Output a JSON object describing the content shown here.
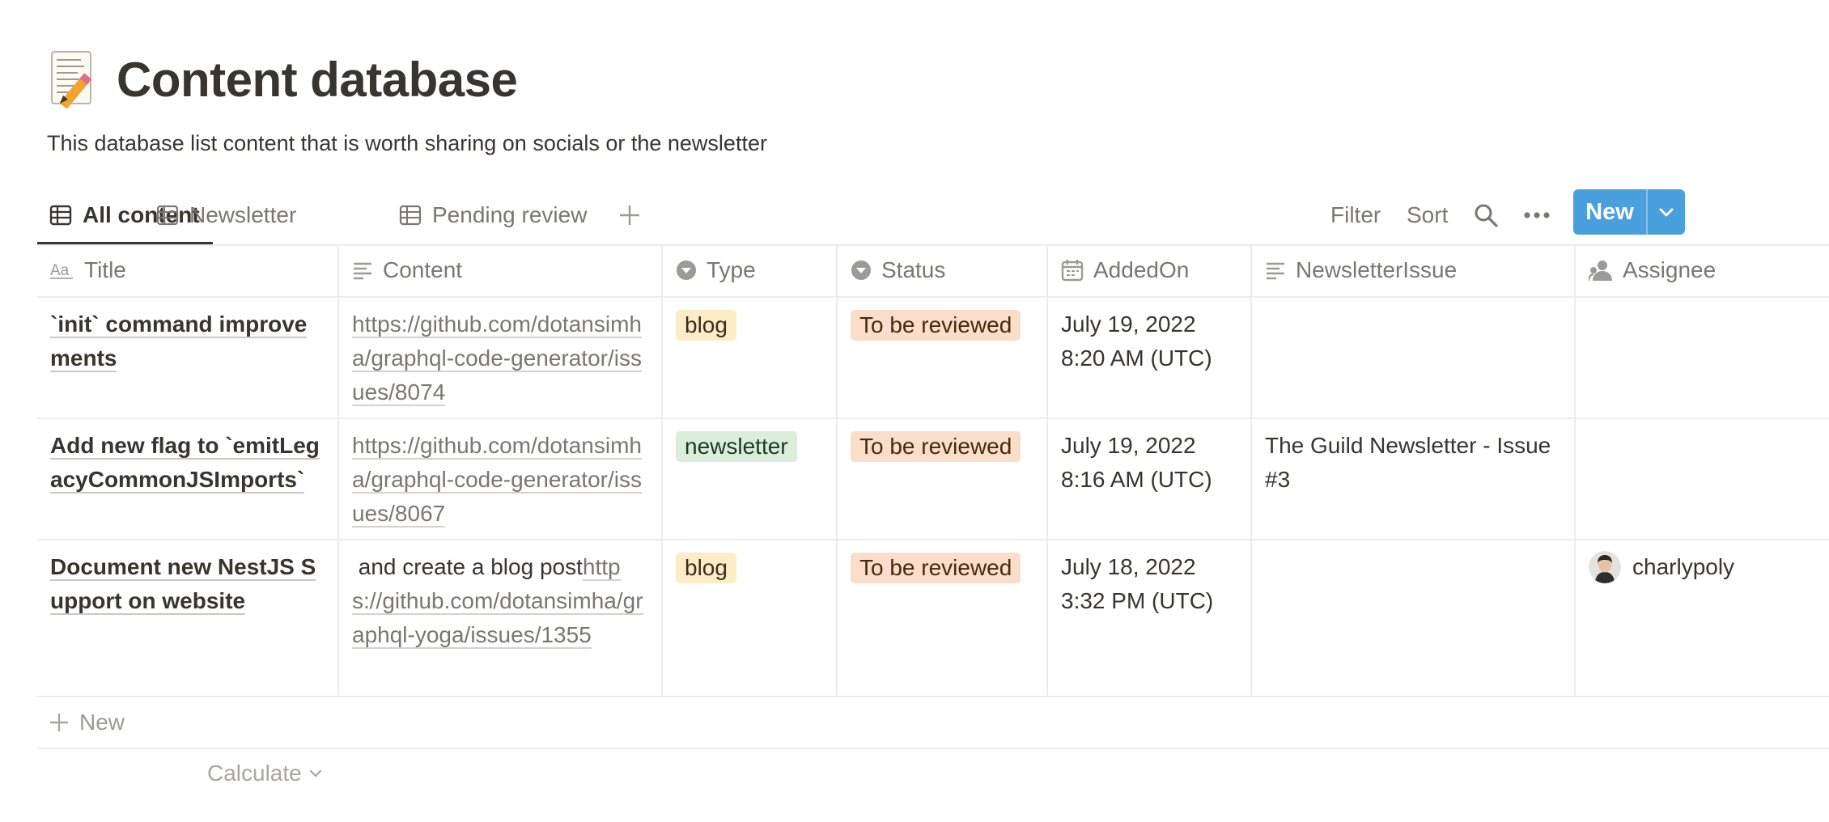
{
  "page": {
    "icon": "memo-pencil-icon",
    "title": "Content database",
    "description": "This database list content that is worth sharing on socials or the newsletter"
  },
  "views": {
    "tabs": [
      {
        "label": "All content",
        "icon": "table-icon",
        "active": true
      },
      {
        "label": "Newsletter",
        "icon": "table-icon",
        "active": false
      },
      {
        "label": "Pending review",
        "icon": "table-icon",
        "active": false
      }
    ],
    "add_view_icon": "plus-icon"
  },
  "toolbar": {
    "filter_label": "Filter",
    "sort_label": "Sort",
    "search_icon": "search-icon",
    "more_icon": "more-horizontal-icon",
    "new_label": "New",
    "new_accent": "#4aa0dc"
  },
  "table": {
    "columns": [
      {
        "label": "Title",
        "icon": "text-aa-icon"
      },
      {
        "label": "Content",
        "icon": "text-lines-icon"
      },
      {
        "label": "Type",
        "icon": "select-icon"
      },
      {
        "label": "Status",
        "icon": "select-icon"
      },
      {
        "label": "AddedOn",
        "icon": "calendar-icon"
      },
      {
        "label": "NewsletterIssue",
        "icon": "text-lines-icon"
      },
      {
        "label": "Assignee",
        "icon": "person-icon"
      }
    ],
    "rows": [
      {
        "title": "`init` command improvements",
        "content_prefix": "",
        "content_link": "https://github.com/dotansimha/graphql-code-generator/issues/8074",
        "type": "blog",
        "status": "To be reviewed",
        "added_date": "July 19, 2022",
        "added_time": "8:20 AM (UTC)",
        "newsletter_issue": "",
        "assignee": ""
      },
      {
        "title": "Add new flag to `emitLegacyCommonJSImports`",
        "content_prefix": "",
        "content_link": "https://github.com/dotansimha/graphql-code-generator/issues/8067",
        "type": "newsletter",
        "status": "To be reviewed",
        "added_date": "July 19, 2022",
        "added_time": "8:16 AM (UTC)",
        "newsletter_issue": "The Guild Newsletter - Issue #3",
        "assignee": ""
      },
      {
        "title": "Document new NestJS Support on website",
        "content_prefix": " and create a blog post",
        "content_link": "https://github.com/dotansimha/graphql-yoga/issues/1355",
        "type": "blog",
        "status": "To be reviewed",
        "added_date": "July 18, 2022",
        "added_time": "3:32 PM (UTC)",
        "newsletter_issue": "",
        "assignee": "charlypoly"
      }
    ],
    "new_row_label": "New",
    "calculate_label": "Calculate"
  },
  "colors": {
    "tag_blog_bg": "#fdecc8",
    "tag_newsletter_bg": "#dbeddb",
    "tag_status_bg": "#fadec9"
  }
}
